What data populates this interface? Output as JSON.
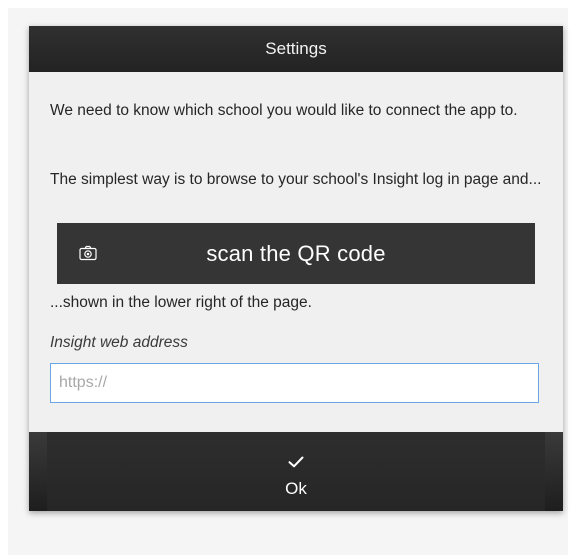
{
  "dialog": {
    "title": "Settings",
    "intro_text": "We need to know which school you would like to connect the app to.",
    "browse_text": "The simplest way is to browse to your school's Insight log in page and...",
    "scan_button": {
      "label": "scan the QR code",
      "icon": "camera-icon"
    },
    "shown_text": "...shown in the lower right of the page.",
    "web_address": {
      "label": "Insight web address",
      "placeholder": "https://",
      "value": ""
    },
    "ok_button": {
      "label": "Ok",
      "icon": "checkmark-icon"
    }
  },
  "colors": {
    "header_bg": "#2a2a2a",
    "dialog_bg": "#f0f0f0",
    "button_bg": "#353535",
    "input_border": "#6aa7e4"
  }
}
